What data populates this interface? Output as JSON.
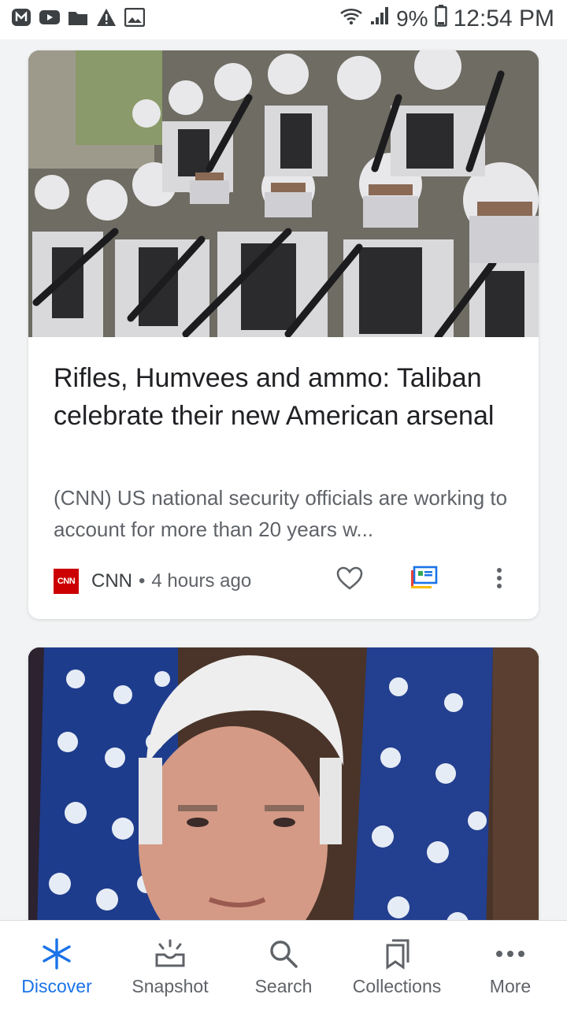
{
  "status_bar": {
    "battery_percent": "9%",
    "time": "12:54 PM",
    "left_icons": [
      "m-badge-icon",
      "youtube-icon",
      "folder-icon",
      "warning-icon",
      "image-icon"
    ]
  },
  "feed": {
    "cards": [
      {
        "image": "taliban-fighters-photo",
        "headline": "Rifles, Humvees and ammo: Taliban celebrate their new American arsenal",
        "snippet": "(CNN) US national security officials are working to account for more than 20 years w...",
        "source_logo": "CNN",
        "source": "CNN",
        "separator": "•",
        "age": "4 hours ago"
      },
      {
        "image": "politician-portrait-with-flags-photo"
      }
    ]
  },
  "bottom_nav": {
    "items": [
      {
        "label": "Discover",
        "icon": "asterisk-icon",
        "active": true
      },
      {
        "label": "Snapshot",
        "icon": "snapshot-icon",
        "active": false
      },
      {
        "label": "Search",
        "icon": "search-icon",
        "active": false
      },
      {
        "label": "Collections",
        "icon": "bookmarks-icon",
        "active": false
      },
      {
        "label": "More",
        "icon": "more-horiz-icon",
        "active": false
      }
    ]
  },
  "colors": {
    "accent": "#1a73e8",
    "cnn_red": "#cc0000"
  }
}
